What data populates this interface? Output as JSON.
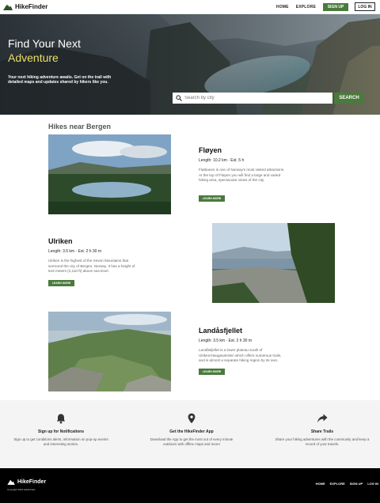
{
  "nav": {
    "brand": "HikeFinder",
    "links": [
      "HOME",
      "EXPLORE"
    ],
    "signup": "SIGN UP",
    "login": "LOG IN"
  },
  "hero": {
    "title_line1": "Find Your Next",
    "title_line2": "Adventure",
    "subtitle": "Your next hiking adventure awaits. Get on the trail with detailed maps and updates shared by hikers like you.",
    "search_placeholder": "Search by city",
    "search_button": "SEARCH",
    "accent_color": "#ebe06a"
  },
  "section": {
    "title": "Hikes near Bergen"
  },
  "trails": [
    {
      "name": "Fløyen",
      "meta": "Length: 10.2 km · Est. 5 h",
      "description": "Fløibanen is one of Norway's most visited attractions. At the top of Fløyen you will find a large and varied hiking area, spectacular views of the city.",
      "button": "LEARN MORE"
    },
    {
      "name": "Ulriken",
      "meta": "Length: 3.5 km · Est. 2 h 30 m",
      "description": "Ulriken is the highest of the Seven Mountains that surround the city of Bergen, Norway. It has a height of 643 meters (2,110 ft) above sea level.",
      "button": "LEARN MORE"
    },
    {
      "name": "Landåsfjellet",
      "meta": "Length: 3.5 km · Est. 2 h 30 m",
      "description": "Landåsfjellet is a lower plateau south of Ulriken/Haugaværden which offers numerous trails, and is almost a separate hiking region by its own.",
      "button": "LEARN MORE"
    }
  ],
  "features": [
    {
      "icon": "bell-icon",
      "title": "Sign up for Notifications",
      "description": "Sign up to get conditions alerts, information on pop-up events and interesting stories."
    },
    {
      "icon": "map-pin-icon",
      "title": "Get the HikeFinder App",
      "description": "Download the App to get the most out of every minute outdoors with offline maps and more!"
    },
    {
      "icon": "share-icon",
      "title": "Share Trails",
      "description": "Share your hiking adventures with the community and keep a record of your travels."
    }
  ],
  "footer": {
    "brand": "HikeFinder",
    "copyright": "Copyright 2022 HikeFinder",
    "links": [
      "HOME",
      "EXPLORE",
      "SIGN UP",
      "LOG IN"
    ]
  },
  "colors": {
    "brand_green": "#4a7a3c",
    "footer_bg": "#000000",
    "features_bg": "#f4f4f4"
  }
}
